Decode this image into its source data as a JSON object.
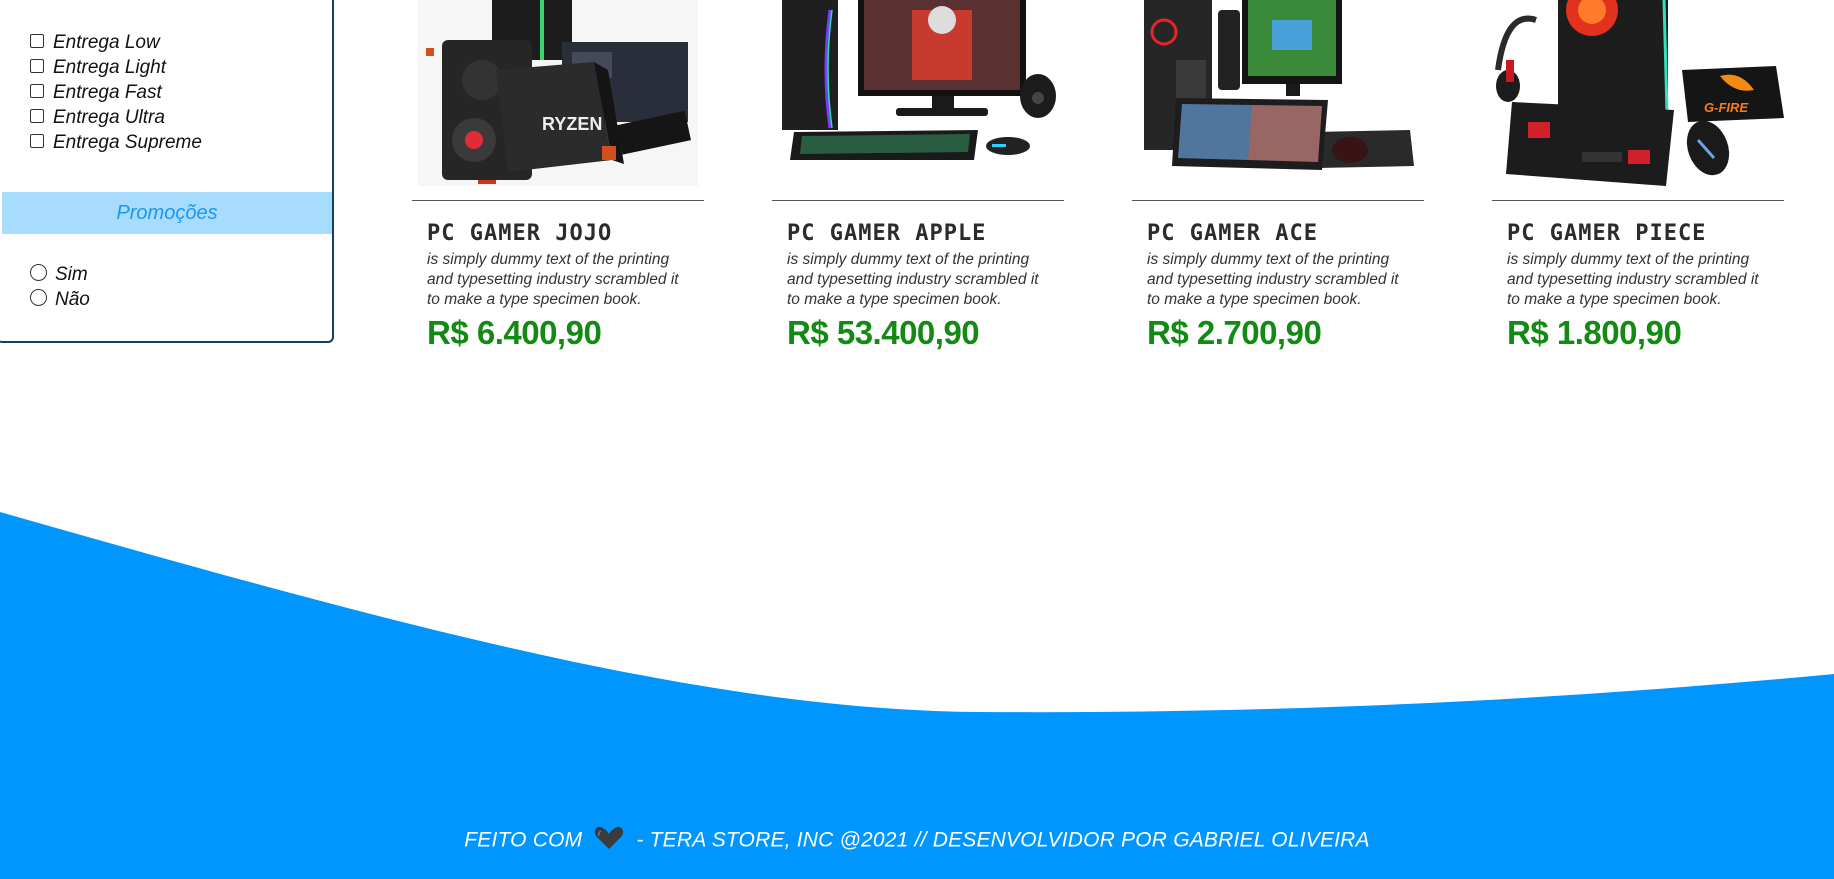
{
  "filters": {
    "delivery_options": [
      {
        "label": "Entrega Low",
        "checked": false
      },
      {
        "label": "Entrega Light",
        "checked": false
      },
      {
        "label": "Entrega Fast",
        "checked": false
      },
      {
        "label": "Entrega Ultra",
        "checked": false
      },
      {
        "label": "Entrega Supreme",
        "checked": false
      }
    ],
    "promotions": {
      "title": "Promoções",
      "options": [
        {
          "label": "Sim",
          "selected": false
        },
        {
          "label": "Não",
          "selected": false
        }
      ]
    }
  },
  "products": [
    {
      "name": "PC GAMER JOJO",
      "description": "is simply dummy text of the printing and typesetting industry scrambled it to make a type specimen book.",
      "price": "R$ 6.400,90",
      "image_icon": "pc-ryzen-components-image"
    },
    {
      "name": "PC GAMER APPLE",
      "description": "is simply dummy text of the printing and typesetting industry scrambled it to make a type specimen book.",
      "price": "R$ 53.400,90",
      "image_icon": "pc-monitor-setup-image"
    },
    {
      "name": "PC GAMER ACE",
      "description": "is simply dummy text of the printing and typesetting industry scrambled it to make a type specimen book.",
      "price": "R$ 2.700,90",
      "image_icon": "pc-rgb-keyboard-image"
    },
    {
      "name": "PC GAMER PIECE",
      "description": "is simply dummy text of the printing and typesetting industry scrambled it to make a type specimen book.",
      "price": "R$ 1.800,90",
      "image_icon": "pc-gfire-combo-image"
    }
  ],
  "footer": {
    "text_before": "FEITO COM",
    "text_after": "- TERA STORE, INC @2021 // DESENVOLVIDOR POR GABRIEL OLIVEIRA",
    "icon": "heart-icon"
  },
  "colors": {
    "accent_blue": "#0096ff",
    "section_bg": "#a8dcff",
    "price_green": "#138a13",
    "sidebar_border": "#0d3f6b"
  }
}
